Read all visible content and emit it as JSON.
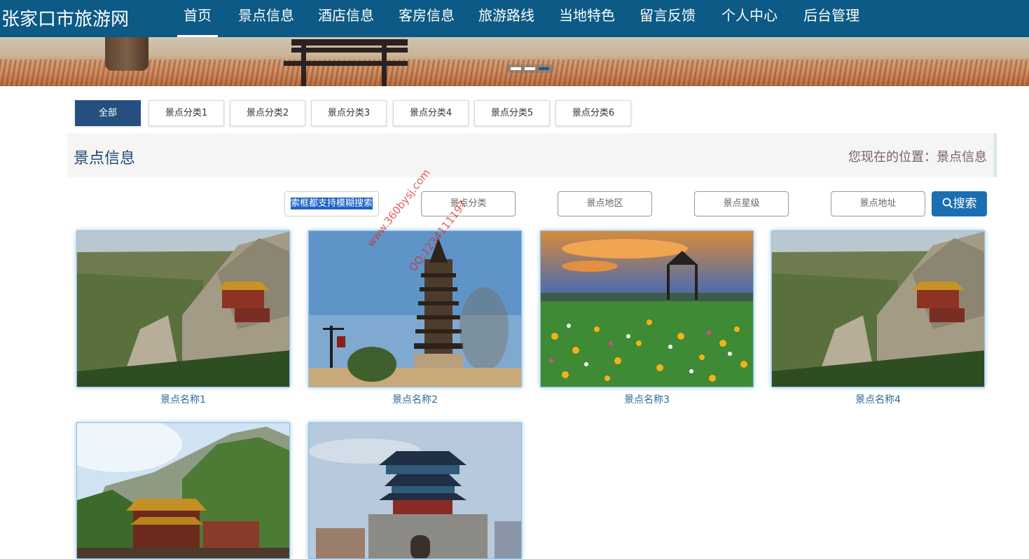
{
  "site": {
    "brand": "张家口市旅游网"
  },
  "nav": [
    {
      "label": "首页",
      "active": true
    },
    {
      "label": "景点信息"
    },
    {
      "label": "酒店信息"
    },
    {
      "label": "客房信息"
    },
    {
      "label": "旅游路线"
    },
    {
      "label": "当地特色"
    },
    {
      "label": "留言反馈"
    },
    {
      "label": "个人中心"
    },
    {
      "label": "后台管理"
    }
  ],
  "banner": {
    "slide_count": 3,
    "active_slide": 3
  },
  "categories": [
    "全部",
    "景点分类1",
    "景点分类2",
    "景点分类3",
    "景点分类4",
    "景点分类5",
    "景点分类6"
  ],
  "section": {
    "title": "景点信息",
    "breadcrumb": "您现在的位置：景点信息"
  },
  "search": {
    "name_value": "索框都支持模糊搜索",
    "category_placeholder": "景点分类",
    "region_placeholder": "景点地区",
    "rating_placeholder": "景点星级",
    "address_placeholder": "景点地址",
    "button_label": "搜索"
  },
  "items": [
    {
      "name": "景点名称1",
      "image": "mountain-temple"
    },
    {
      "name": "景点名称2",
      "image": "pagoda"
    },
    {
      "name": "景点名称3",
      "image": "flower-field-pavilion"
    },
    {
      "name": "景点名称4",
      "image": "mountain-temple"
    },
    {
      "name": "",
      "image": "cliff-temple"
    },
    {
      "name": "",
      "image": "gate-tower"
    }
  ],
  "watermark": {
    "site": "www.360bysj.com",
    "qq": "QQ:1234111197"
  },
  "colors": {
    "nav_bg": "#0c5a85",
    "accent": "#1a6fb3",
    "active_tab": "#254f7e",
    "caption": "#2b6a9b"
  }
}
